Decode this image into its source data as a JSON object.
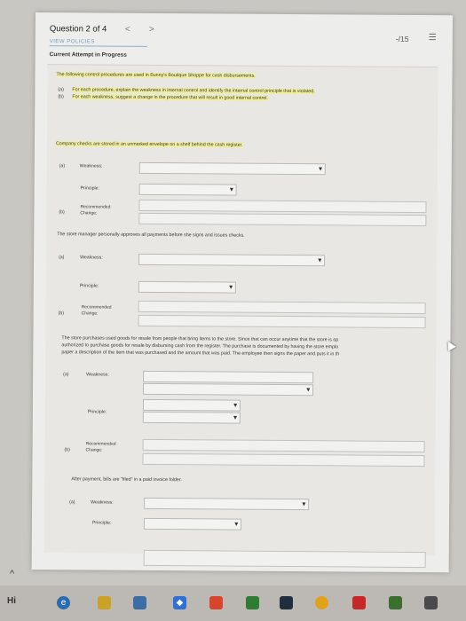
{
  "header": {
    "question": "Question 2 of 4",
    "prev": "<",
    "next": ">",
    "score": "-/15",
    "menu": "☰",
    "faded_title": "VIEW POLICIES",
    "attempt": "Current Attempt in Progress"
  },
  "intro": "The following control procedures are used in Bunny's Boutique Shoppe for cash disbursements.",
  "instructions": [
    {
      "tag": "(a)",
      "text": "For each procedure, explain the weakness in internal control and identify the internal control principle that is violated."
    },
    {
      "tag": "(b)",
      "text": "For each weakness, suggest a change in the procedure that will result in good internal control."
    }
  ],
  "labels": {
    "a": "(a)",
    "b": "(b)",
    "weakness": "Weakness:",
    "principle": "Principle:",
    "recommended": "Recommended",
    "change": "Change:"
  },
  "procedures": [
    {
      "text": "Company checks are stored in an unmarked envelope on a shelf behind the cash register."
    },
    {
      "text": "The store manager personally approves all payments before she signs and issues checks."
    },
    {
      "lines": [
        "The store purchases used goods for resale from people that bring items to the store. Since that can occur anytime that the store is op",
        "authorized to purchase goods for resale by disbursing cash from the register. The purchase is documented by having the store emplo",
        "paper a description of the item that was purchased and the amount that was paid. The employee then signs the paper and puts it in th"
      ]
    },
    {
      "text": "After payment, bills are \"filed\" in a paid invoice folder."
    }
  ],
  "icons": {
    "chevron": "▾",
    "cursor": "cursor-icon"
  },
  "taskbar": {
    "app_label": "Hi"
  }
}
